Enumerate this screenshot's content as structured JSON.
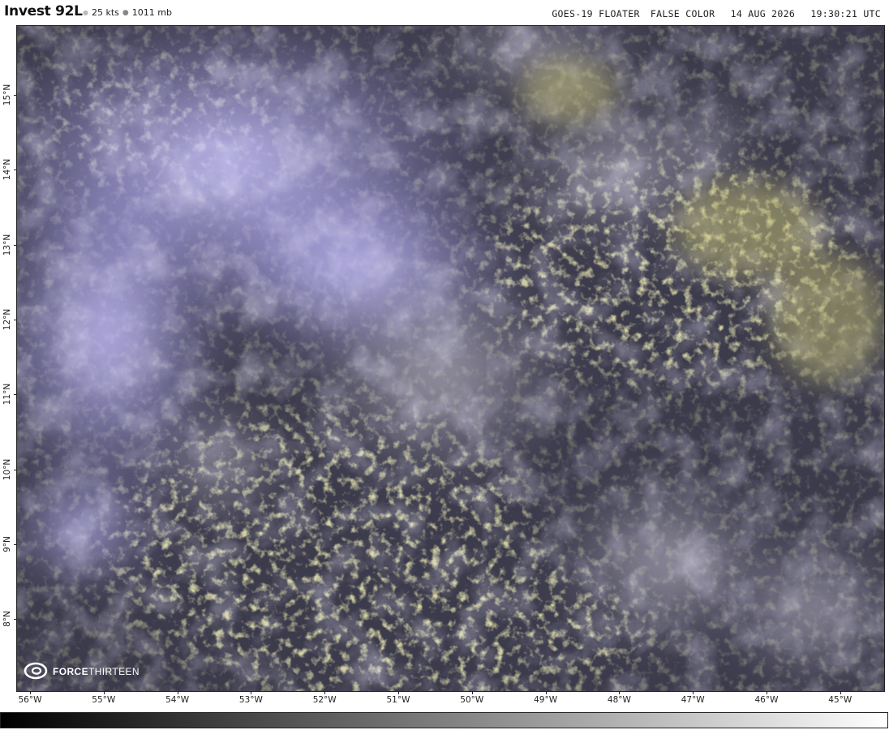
{
  "header": {
    "storm_name": "Invest 92L",
    "wind": "25 kts",
    "pressure": "1011 mb",
    "satellite": "GOES-19 FLOATER",
    "product": "FALSE COLOR",
    "date": "14 AUG 2026",
    "time": "19:30:21 UTC"
  },
  "map": {
    "lat_labels": [
      "15°N",
      "14°N",
      "13°N",
      "12°N",
      "11°N",
      "10°N",
      "9°N",
      "8°N"
    ],
    "lon_labels": [
      "56°W",
      "55°W",
      "54°W",
      "53°W",
      "52°W",
      "51°W",
      "50°W",
      "49°W",
      "48°W",
      "47°W",
      "46°W",
      "45°W"
    ]
  },
  "logo": {
    "text_bold": "FORCE",
    "text_regular": "THIRTEEN"
  },
  "colors": {
    "ocean": "#3a3a52",
    "high_cloud": "#b8b2f2",
    "low_cloud": "#d8d68a",
    "colorbar_start": "#000000",
    "colorbar_end": "#ffffff"
  }
}
